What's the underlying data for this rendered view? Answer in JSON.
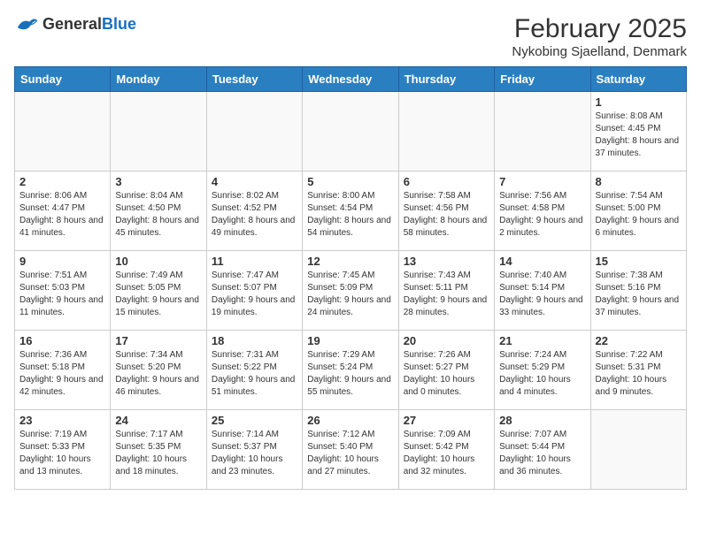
{
  "header": {
    "logo_general": "General",
    "logo_blue": "Blue",
    "month": "February 2025",
    "location": "Nykobing Sjaelland, Denmark"
  },
  "weekdays": [
    "Sunday",
    "Monday",
    "Tuesday",
    "Wednesday",
    "Thursday",
    "Friday",
    "Saturday"
  ],
  "weeks": [
    [
      {
        "day": "",
        "info": ""
      },
      {
        "day": "",
        "info": ""
      },
      {
        "day": "",
        "info": ""
      },
      {
        "day": "",
        "info": ""
      },
      {
        "day": "",
        "info": ""
      },
      {
        "day": "",
        "info": ""
      },
      {
        "day": "1",
        "info": "Sunrise: 8:08 AM\nSunset: 4:45 PM\nDaylight: 8 hours and 37 minutes."
      }
    ],
    [
      {
        "day": "2",
        "info": "Sunrise: 8:06 AM\nSunset: 4:47 PM\nDaylight: 8 hours and 41 minutes."
      },
      {
        "day": "3",
        "info": "Sunrise: 8:04 AM\nSunset: 4:50 PM\nDaylight: 8 hours and 45 minutes."
      },
      {
        "day": "4",
        "info": "Sunrise: 8:02 AM\nSunset: 4:52 PM\nDaylight: 8 hours and 49 minutes."
      },
      {
        "day": "5",
        "info": "Sunrise: 8:00 AM\nSunset: 4:54 PM\nDaylight: 8 hours and 54 minutes."
      },
      {
        "day": "6",
        "info": "Sunrise: 7:58 AM\nSunset: 4:56 PM\nDaylight: 8 hours and 58 minutes."
      },
      {
        "day": "7",
        "info": "Sunrise: 7:56 AM\nSunset: 4:58 PM\nDaylight: 9 hours and 2 minutes."
      },
      {
        "day": "8",
        "info": "Sunrise: 7:54 AM\nSunset: 5:00 PM\nDaylight: 9 hours and 6 minutes."
      }
    ],
    [
      {
        "day": "9",
        "info": "Sunrise: 7:51 AM\nSunset: 5:03 PM\nDaylight: 9 hours and 11 minutes."
      },
      {
        "day": "10",
        "info": "Sunrise: 7:49 AM\nSunset: 5:05 PM\nDaylight: 9 hours and 15 minutes."
      },
      {
        "day": "11",
        "info": "Sunrise: 7:47 AM\nSunset: 5:07 PM\nDaylight: 9 hours and 19 minutes."
      },
      {
        "day": "12",
        "info": "Sunrise: 7:45 AM\nSunset: 5:09 PM\nDaylight: 9 hours and 24 minutes."
      },
      {
        "day": "13",
        "info": "Sunrise: 7:43 AM\nSunset: 5:11 PM\nDaylight: 9 hours and 28 minutes."
      },
      {
        "day": "14",
        "info": "Sunrise: 7:40 AM\nSunset: 5:14 PM\nDaylight: 9 hours and 33 minutes."
      },
      {
        "day": "15",
        "info": "Sunrise: 7:38 AM\nSunset: 5:16 PM\nDaylight: 9 hours and 37 minutes."
      }
    ],
    [
      {
        "day": "16",
        "info": "Sunrise: 7:36 AM\nSunset: 5:18 PM\nDaylight: 9 hours and 42 minutes."
      },
      {
        "day": "17",
        "info": "Sunrise: 7:34 AM\nSunset: 5:20 PM\nDaylight: 9 hours and 46 minutes."
      },
      {
        "day": "18",
        "info": "Sunrise: 7:31 AM\nSunset: 5:22 PM\nDaylight: 9 hours and 51 minutes."
      },
      {
        "day": "19",
        "info": "Sunrise: 7:29 AM\nSunset: 5:24 PM\nDaylight: 9 hours and 55 minutes."
      },
      {
        "day": "20",
        "info": "Sunrise: 7:26 AM\nSunset: 5:27 PM\nDaylight: 10 hours and 0 minutes."
      },
      {
        "day": "21",
        "info": "Sunrise: 7:24 AM\nSunset: 5:29 PM\nDaylight: 10 hours and 4 minutes."
      },
      {
        "day": "22",
        "info": "Sunrise: 7:22 AM\nSunset: 5:31 PM\nDaylight: 10 hours and 9 minutes."
      }
    ],
    [
      {
        "day": "23",
        "info": "Sunrise: 7:19 AM\nSunset: 5:33 PM\nDaylight: 10 hours and 13 minutes."
      },
      {
        "day": "24",
        "info": "Sunrise: 7:17 AM\nSunset: 5:35 PM\nDaylight: 10 hours and 18 minutes."
      },
      {
        "day": "25",
        "info": "Sunrise: 7:14 AM\nSunset: 5:37 PM\nDaylight: 10 hours and 23 minutes."
      },
      {
        "day": "26",
        "info": "Sunrise: 7:12 AM\nSunset: 5:40 PM\nDaylight: 10 hours and 27 minutes."
      },
      {
        "day": "27",
        "info": "Sunrise: 7:09 AM\nSunset: 5:42 PM\nDaylight: 10 hours and 32 minutes."
      },
      {
        "day": "28",
        "info": "Sunrise: 7:07 AM\nSunset: 5:44 PM\nDaylight: 10 hours and 36 minutes."
      },
      {
        "day": "",
        "info": ""
      }
    ]
  ]
}
